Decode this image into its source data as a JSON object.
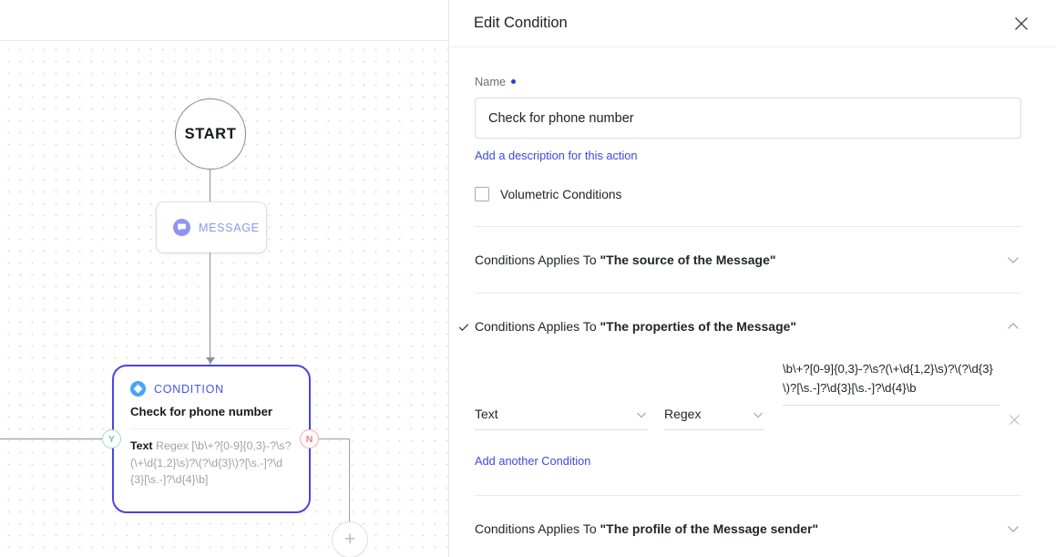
{
  "panel": {
    "title": "Edit Condition",
    "close_icon": "close-icon",
    "name_label": "Name",
    "name_value": "Check for phone number",
    "name_placeholder": "Name",
    "description_link": "Add a description for this action",
    "volumetric_label": "Volumetric Conditions",
    "volumetric_checked": false,
    "sections": [
      {
        "prefix": "Conditions Applies To ",
        "target": "\"The source of the Message\"",
        "expanded": false,
        "checked": false,
        "chevron": "chevron-down-icon"
      },
      {
        "prefix": "Conditions Applies To ",
        "target": "\"The properties of the Message\"",
        "expanded": true,
        "checked": true,
        "chevron": "chevron-up-icon"
      },
      {
        "prefix": "Conditions Applies To ",
        "target": "\"The profile of the Message sender\"",
        "expanded": false,
        "checked": false,
        "chevron": "chevron-down-icon"
      }
    ],
    "condition_row": {
      "property": "Text",
      "operator": "Regex",
      "value": "\\b\\+?[0-9]{0,3}-?\\s?(\\+\\d{1,2}\\s)?\\(?\\d{3}\\)?[\\s.-]?\\d{3}[\\s.-]?\\d{4}\\b",
      "remove_icon": "close-icon"
    },
    "add_condition_link": "Add another Condition"
  },
  "canvas": {
    "start_node": {
      "label": "START"
    },
    "message_node": {
      "label": "MESSAGE",
      "icon": "chat-bubble-icon"
    },
    "condition_node": {
      "kind": "CONDITION",
      "icon": "diamond-icon",
      "title": "Check for phone number",
      "property": "Text",
      "operator": "Regex",
      "value": "[\\b\\+?[0-9]{0,3}-?\\s?(\\+\\d{1,2}\\s)?\\(?\\d{3}\\)?[\\s.-]?\\d{3}[\\s.-]?\\d{4}\\b]",
      "port_yes": "Y",
      "port_no": "N"
    },
    "add_node_button": "+"
  },
  "colors": {
    "accent_blue": "#3b49df",
    "node_border": "#4a45e0",
    "message_purple": "#8e94f4",
    "condition_blue": "#49a3f5",
    "yes_green": "#6fc8a6",
    "no_red": "#ef7c7c"
  }
}
